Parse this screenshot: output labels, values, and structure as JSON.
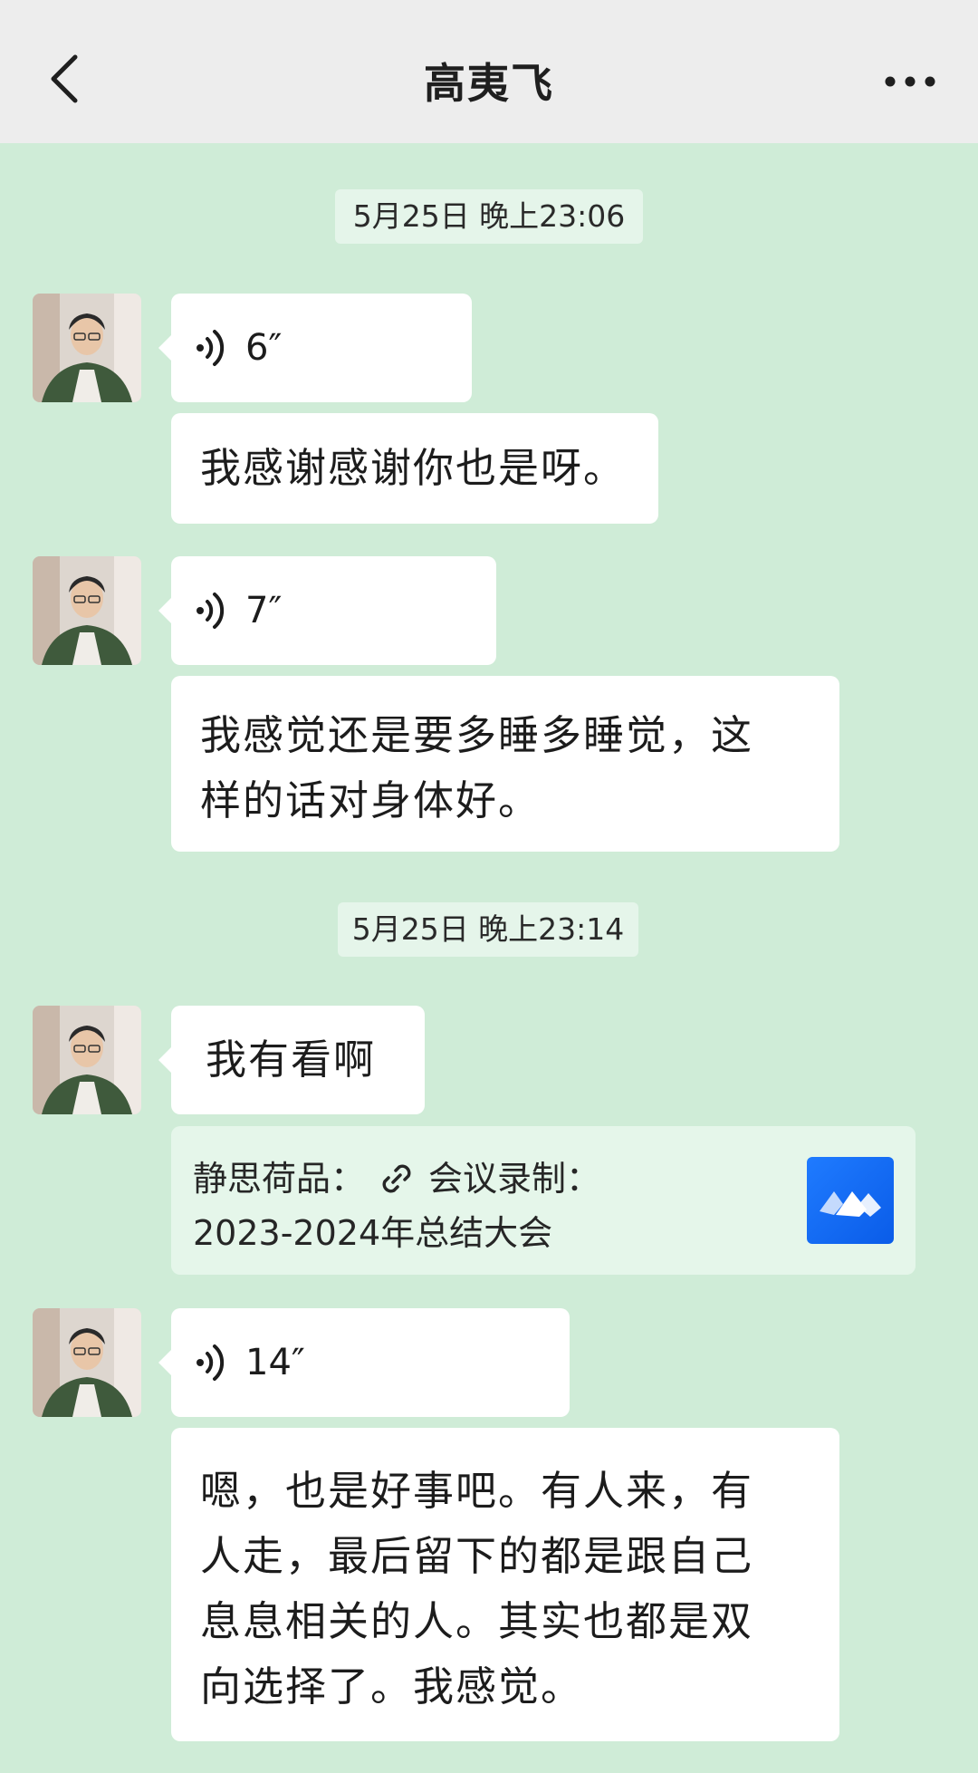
{
  "header": {
    "title": "高夷飞",
    "back_icon": "chevron-left-icon",
    "more_icon": "more-dots-icon"
  },
  "colors": {
    "background": "#cfecd7",
    "header_bg": "#ededed",
    "bubble_bg": "#ffffff",
    "link_card_bg": "#e5f6ea",
    "app_logo_blue": "#1f7bff"
  },
  "messages": {
    "ts1": "5月25日 晚上23:06",
    "voice1": "6″",
    "text1": "我感谢感谢你也是呀。",
    "voice2": "7″",
    "text2_line1": "我感觉还是要多睡多睡觉，这",
    "text2_line2": "样的话对身体好。",
    "ts2": "5月25日 晚上23:14",
    "text3": "我有看啊",
    "link_card": {
      "prefix": "静思荷品：",
      "title_part1": "会议录制：",
      "title_part2": "2023-2024年总结大会",
      "icon": "link-icon",
      "app_logo": "tencent-meeting-logo"
    },
    "voice3": "14″",
    "text4_line1": "嗯，也是好事吧。有人来，有",
    "text4_line2": "人走，最后留下的都是跟自己",
    "text4_line3": "息息相关的人。其实也都是双",
    "text4_line4": "向选择了。我感觉。"
  }
}
